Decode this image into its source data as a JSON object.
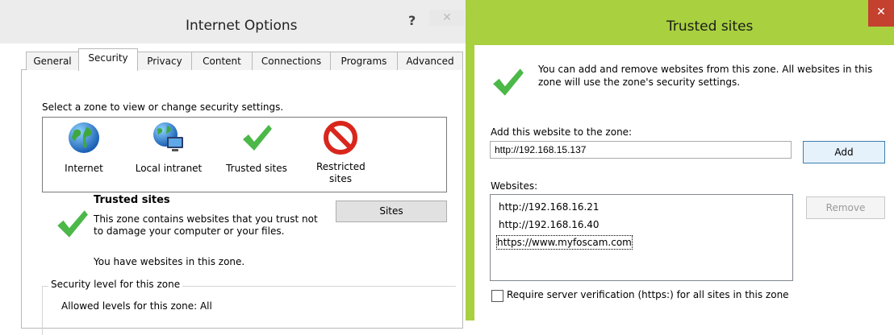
{
  "internet_options": {
    "title": "Internet Options",
    "help": "?",
    "close": "✕",
    "tabs": [
      "General",
      "Security",
      "Privacy",
      "Content",
      "Connections",
      "Programs",
      "Advanced"
    ],
    "active_tab": "Security",
    "zone_prompt": "Select a zone to view or change security settings.",
    "zones": [
      {
        "label": "Internet",
        "icon": "globe-icon"
      },
      {
        "label": "Local intranet",
        "icon": "intranet-icon"
      },
      {
        "label": "Trusted sites",
        "icon": "checkmark-icon"
      },
      {
        "label": "Restricted sites",
        "icon": "restricted-icon"
      }
    ],
    "zone_heading": "Trusted sites",
    "zone_description": "This zone contains websites that you trust not to damage your computer or your files.",
    "zone_note": "You have websites in this zone.",
    "sites_button": "Sites",
    "security_level_legend": "Security level for this zone",
    "allowed_levels": "Allowed levels for this zone: All"
  },
  "trusted_sites": {
    "title": "Trusted sites",
    "close": "✕",
    "info": "You can add and remove websites from this zone. All websites in this zone will use the zone's security settings.",
    "add_label": "Add this website to the zone:",
    "add_value": "http://192.168.15.137",
    "add_button": "Add",
    "websites_label": "Websites:",
    "websites": [
      "http://192.168.16.21",
      "http://192.168.16.40",
      "https://www.myfoscam.com"
    ],
    "remove_button": "Remove",
    "verify_label": "Require server verification (https:) for all sites in this zone",
    "verify_checked": false
  },
  "colors": {
    "accent_green": "#a8d03f",
    "close_red": "#c4402f",
    "check_green": "#4cb848"
  }
}
